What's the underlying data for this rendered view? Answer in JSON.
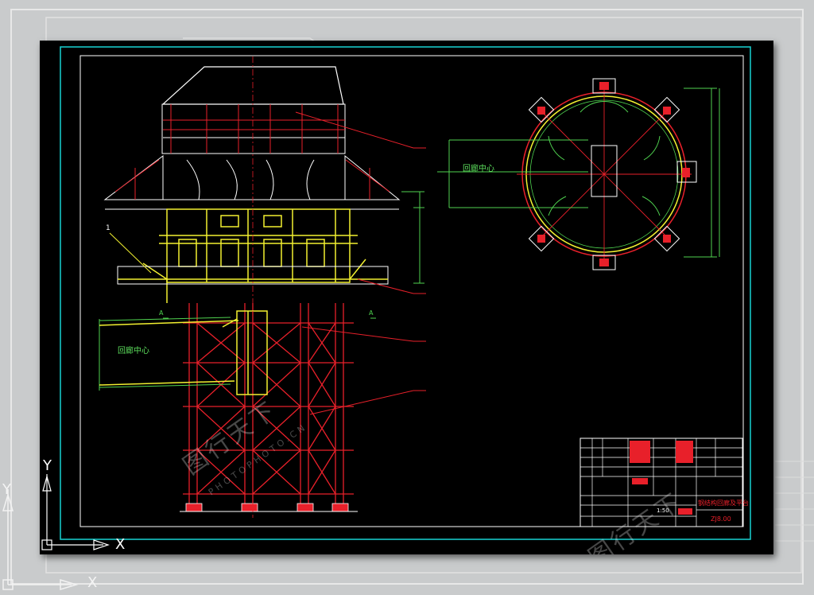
{
  "labels": {
    "center_left": "回廊中心",
    "center_right": "回廊中心",
    "leader_1": "1",
    "section_a": "A",
    "ucs_x": "X",
    "ucs_y": "Y",
    "bg_ucs_x": "X",
    "bg_ucs_y": "Y"
  },
  "title_block": {
    "drawing_name": "钢结构回廊及平台",
    "drawing_no": "ZJ8.00",
    "scale": "1:50"
  },
  "watermark": {
    "text": "图行天下",
    "sub": "PHOTOPHOTO.CN"
  },
  "colors": {
    "canvas": "#000000",
    "structure": "#e8202a",
    "platform": "#f2f030",
    "outline": "#ffffff",
    "dimension": "#4fd24f",
    "border": "#19d3d3"
  }
}
